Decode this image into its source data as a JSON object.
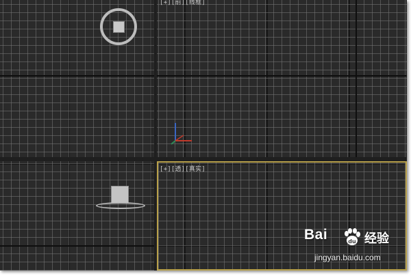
{
  "viewports": {
    "top_left": {
      "label": ""
    },
    "top_right": {
      "label": "[+][前][线框]"
    },
    "bottom_left": {
      "label": ""
    },
    "bottom_right": {
      "label": "[+][透][真实]"
    }
  },
  "icons": {
    "gizmo": "axis-tripod-icon",
    "paw": "baidu-paw-icon"
  },
  "colors": {
    "grid_bg": "#2a2a2a",
    "grid_line": "#787878",
    "active_border": "#b8a04a",
    "axis_x": "#c0392b",
    "axis_y": "#2e8b57",
    "axis_z": "#3a66c4"
  },
  "watermark": {
    "brand": "Bai",
    "product": "经验",
    "url": "jingyan.baidu.com"
  }
}
